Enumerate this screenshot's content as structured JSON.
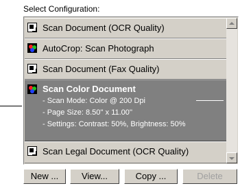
{
  "header": {
    "title": "Select Configuration:"
  },
  "list": {
    "items": [
      {
        "label": "Scan Document (OCR Quality)",
        "icon": "document-icon"
      },
      {
        "label": "AutoCrop: Scan Photograph",
        "icon": "color-photo-icon"
      },
      {
        "label": "Scan Document (Fax Quality)",
        "icon": "document-icon"
      },
      {
        "label": "Scan Color Document",
        "icon": "color-photo-icon",
        "selected": true,
        "details": [
          "- Scan Mode: Color @ 200 Dpi",
          "- Page Size:  8.50'' x 11.00''",
          "- Settings: Contrast: 50%, Brightness: 50%"
        ]
      },
      {
        "label": "Scan Legal Document (OCR Quality)",
        "icon": "document-icon"
      }
    ]
  },
  "buttons": {
    "new": "New ...",
    "view": "View...",
    "copy": "Copy ...",
    "delete": "Delete"
  },
  "colors": {
    "panel": "#d4d0c8",
    "selected": "#808080",
    "disabled_text": "#a0a0a0"
  }
}
